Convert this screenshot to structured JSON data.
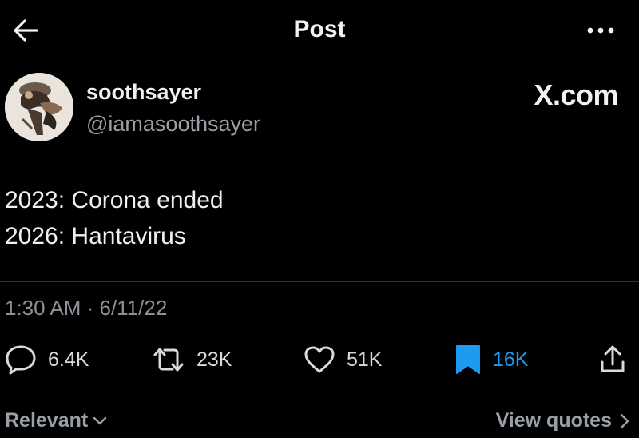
{
  "header": {
    "title": "Post",
    "back_icon": "arrow-left-icon",
    "more_icon": "ellipsis-icon"
  },
  "author": {
    "display_name": "soothsayer",
    "handle": "@iamasoothsayer",
    "avatar_icon": "avatar-image"
  },
  "watermark": "X.com",
  "tweet": {
    "lines": [
      "2023: Corona ended",
      "2026: Hantavirus"
    ]
  },
  "timestamp": "1:30 AM · 6/11/22",
  "actions": {
    "replies": "6.4K",
    "reposts": "23K",
    "likes": "51K",
    "bookmarks": "16K"
  },
  "footer": {
    "sort_label": "Relevant",
    "quotes_label": "View quotes"
  },
  "colors": {
    "background": "#000000",
    "text": "#e7e9ea",
    "muted": "#8b9196",
    "accent": "#1d9bf0",
    "divider": "#2f3336"
  }
}
